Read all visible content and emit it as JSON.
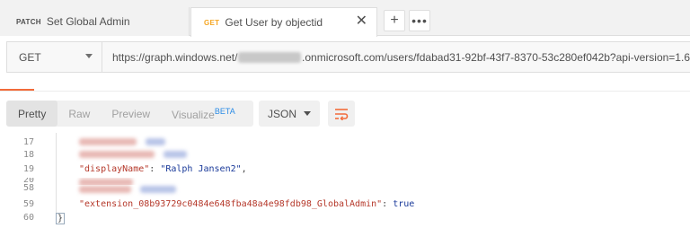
{
  "tabs": [
    {
      "method": "PATCH",
      "title": "Set Global Admin"
    },
    {
      "method": "GET",
      "title": "Get User by objectid",
      "close": "✕"
    }
  ],
  "tab_buttons": {
    "plus": "+",
    "more": "•••"
  },
  "request": {
    "method": "GET",
    "url_prefix": "https://graph.windows.net/",
    "url_suffix": ".onmicrosoft.com/users/fdabad31-92bf-43f7-8370-53c280ef042b?api-version=1.6"
  },
  "response_toolbar": {
    "views": [
      "Pretty",
      "Raw",
      "Preview",
      "Visualize"
    ],
    "beta_label": "BETA",
    "format": "JSON"
  },
  "code_lines": [
    {
      "num": "17"
    },
    {
      "num": "18"
    },
    {
      "num": "19",
      "key": "\"displayName\"",
      "sep": ": ",
      "value": "\"Ralph Jansen2\"",
      "end": ","
    },
    {
      "num": "20"
    },
    {
      "num": "58"
    },
    {
      "num": "59",
      "key": "\"extension_08b93729c0484e648fba48a4e98fdb98_GlobalAdmin\"",
      "sep": ": ",
      "value": "true"
    },
    {
      "num": "60",
      "value": "}"
    }
  ],
  "colors": {
    "accent": "#f26b3a",
    "json_key": "#b5382a",
    "json_string": "#1a3a9a",
    "get_method": "#f5a623"
  }
}
